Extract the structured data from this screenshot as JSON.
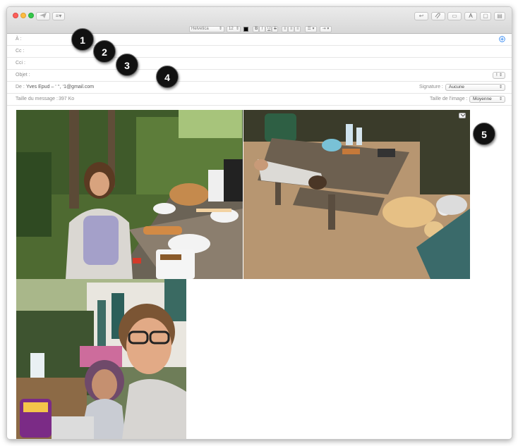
{
  "toolbar": {
    "list_btn": "≡▾",
    "reply_btn": "↩",
    "attach_btn": "📎",
    "photo_btn": "▭",
    "font_btn": "A",
    "window_btn": "▢",
    "panel_btn": "▤"
  },
  "format_bar": {
    "font_name": "Helvetica",
    "font_size": "12",
    "bold": "B",
    "italic": "I",
    "underline": "U",
    "strike": "S",
    "align_left": "≡",
    "align_center": "≡",
    "align_right": "≡",
    "list": "☰ ▾",
    "indent": "⇥ ▾"
  },
  "header": {
    "to_label": "À :",
    "cc_label": "Cc :",
    "bcc_label": "Cci :",
    "subject_label": "Objet :",
    "priority_value": "!",
    "from_label": "De :",
    "from_value": "Yves Epud – ‘   ‘‘,   ‘1@gmail.com",
    "signature_label": "Signature :",
    "signature_value": "Aucune",
    "size_label": "Taille du message :",
    "size_value": "397 Ko",
    "image_size_label": "Taille de l'image :",
    "image_size_value": "Moyenne"
  },
  "annotations": [
    "1",
    "2",
    "3",
    "4",
    "5"
  ],
  "colors": {
    "close": "#fc605b",
    "minimize": "#fdbc40",
    "zoom": "#34c84a",
    "add_contact": "#3b8df2"
  }
}
